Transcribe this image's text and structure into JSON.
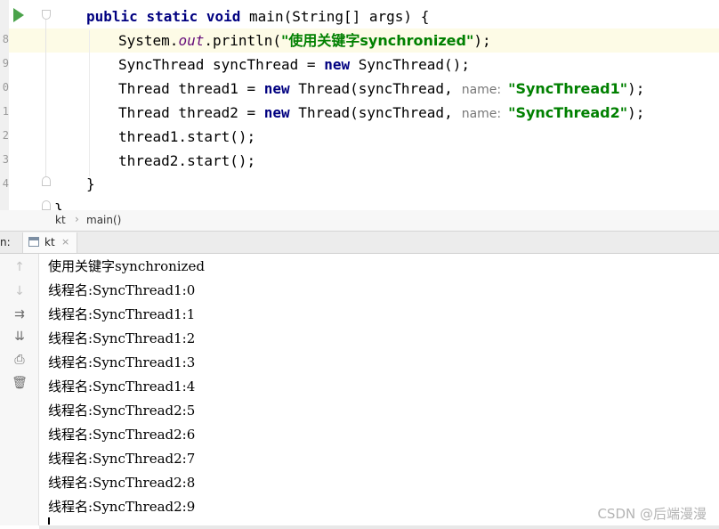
{
  "editor": {
    "line_number_fragments": [
      "",
      "8",
      "9",
      "0",
      "1",
      "2",
      "3",
      "4",
      ""
    ],
    "code": {
      "main_sig": {
        "kw1": "public",
        "kw2": "static",
        "kw3": "void",
        "rest": " main(String[] args) {"
      },
      "println": {
        "pre": "System.",
        "field": "out",
        "post": ".println(",
        "str": "\"使用关键字synchronized\"",
        "end": ");"
      },
      "sync_decl": {
        "pre": "SyncThread syncThread = ",
        "kw": "new",
        "post": " SyncThread();"
      },
      "thread1_decl": {
        "pre": "Thread thread1 = ",
        "kw": "new",
        "post": " Thread(syncThread,",
        "hint": "name:",
        "str": "\"SyncThread1\"",
        "end": ");"
      },
      "thread2_decl": {
        "pre": "Thread thread2 = ",
        "kw": "new",
        "post": " Thread(syncThread,",
        "hint": "name:",
        "str": "\"SyncThread2\"",
        "end": ");"
      },
      "start1": "thread1.start();",
      "start2": "thread2.start();",
      "close_method": "}",
      "close_class": "}"
    }
  },
  "breadcrumb": {
    "items": [
      "kt",
      "main()"
    ],
    "separator": "›"
  },
  "run_panel": {
    "label": "n:",
    "tab": {
      "label": "kt",
      "close": "×"
    },
    "toolbar": [
      {
        "name": "scroll-up-icon",
        "glyph": "↑",
        "enabled": false
      },
      {
        "name": "scroll-down-icon",
        "glyph": "↓",
        "enabled": false
      },
      {
        "name": "soft-wrap-icon",
        "glyph": "⇉",
        "enabled": true
      },
      {
        "name": "scroll-to-end-icon",
        "glyph": "⇊",
        "enabled": true
      },
      {
        "name": "print-icon",
        "glyph": "⎙",
        "enabled": true
      },
      {
        "name": "trash-icon",
        "glyph": "🗑",
        "enabled": true
      }
    ],
    "console_output": [
      "使用关键字synchronized",
      "线程名:SyncThread1:0",
      "线程名:SyncThread1:1",
      "线程名:SyncThread1:2",
      "线程名:SyncThread1:3",
      "线程名:SyncThread1:4",
      "线程名:SyncThread2:5",
      "线程名:SyncThread2:6",
      "线程名:SyncThread2:7",
      "线程名:SyncThread2:8",
      "线程名:SyncThread2:9"
    ]
  },
  "watermark": "CSDN @后端漫漫",
  "colors": {
    "keyword": "#000080",
    "string": "#008000",
    "static_field": "#660e7a",
    "run_icon": "#4aa24a",
    "current_line": "#fdfbe6"
  }
}
